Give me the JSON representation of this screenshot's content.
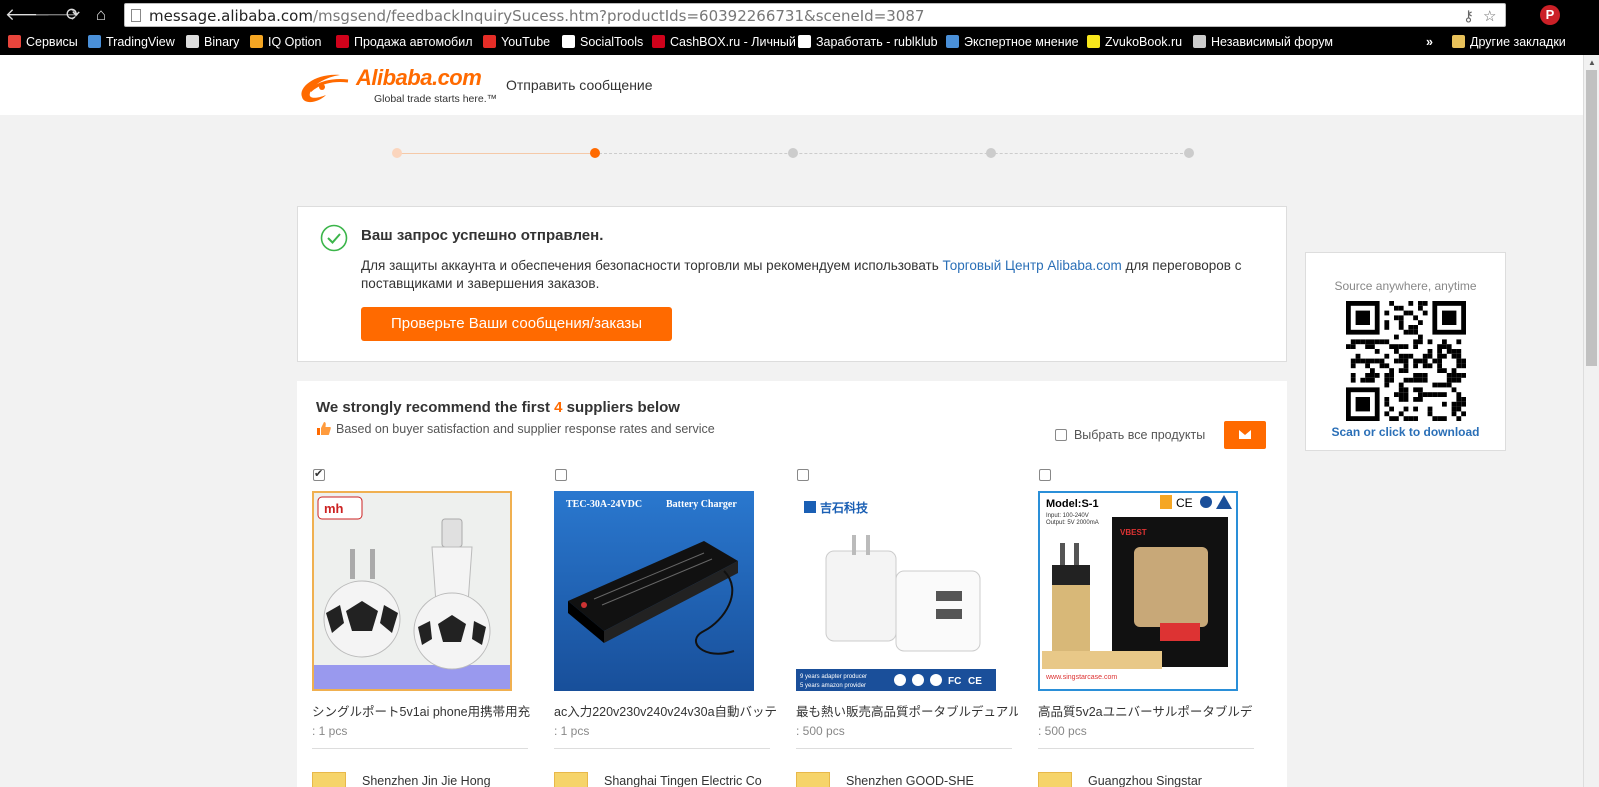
{
  "browser": {
    "url_host": "message.alibaba.com",
    "url_path": "/msgsend/feedbackInquirySucess.htm?productIds=60392266731&sceneId=3087",
    "bookmarks": [
      {
        "label": "Сервисы",
        "color": "#e8453c"
      },
      {
        "label": "TradingView",
        "color": "#4a90d9"
      },
      {
        "label": "Binary",
        "color": "#dddddd"
      },
      {
        "label": "IQ Option",
        "color": "#f5a623"
      },
      {
        "label": "Продажа автомобил",
        "color": "#d0021b"
      },
      {
        "label": "YouTube",
        "color": "#e52d27"
      },
      {
        "label": "SocialTools",
        "color": "#ffffff"
      },
      {
        "label": "CashBOX.ru - Личный",
        "color": "#d0021b"
      },
      {
        "label": "Заработать - rublklub",
        "color": "#ffffff"
      },
      {
        "label": "Экспертное мнение",
        "color": "#4a90d9"
      },
      {
        "label": "ZvukoBook.ru",
        "color": "#f8e71c"
      },
      {
        "label": "Независимый форум",
        "color": "#cccccc"
      }
    ],
    "more": "»",
    "other_bookmarks": "Другие закладки"
  },
  "header": {
    "logo_word": "Alibaba.com",
    "logo_tagline": "Global trade starts here.™",
    "title": "Отправить сообщение"
  },
  "progress": {
    "total_steps": 5,
    "current_step": 2
  },
  "success": {
    "title": "Ваш запрос успешно отправлен.",
    "text_before": "Для защиты аккаунта и обеспечения безопасности торговли мы рекомендуем использовать ",
    "link": "Торговый Центр Alibaba.com",
    "text_after": " для переговоров с поставщиками и завершения заказов.",
    "button": "Проверьте Ваши сообщения/заказы"
  },
  "qr": {
    "caption": "Source anywhere, anytime",
    "link": "Scan or click to download"
  },
  "recommend": {
    "title_before": "We strongly recommend the first ",
    "title_num": "4",
    "title_after": " suppliers below",
    "subtitle": "Based on buyer satisfaction and supplier response rates and service",
    "select_all": "Выбрать все продукты"
  },
  "products": [
    {
      "name": "シングルポート5v1ai phone用携帯用充",
      "qty": ": 1 pcs",
      "supplier": "Shenzhen Jin Jie Hong",
      "checked": true
    },
    {
      "name": "ac入力220v230v240v24v30a自動バッテ",
      "qty": ": 1 pcs",
      "supplier": "Shanghai Tingen Electric Co",
      "checked": false,
      "image_text_1": "TEC-30A-24VDC",
      "image_text_2": "Battery Charger"
    },
    {
      "name": "最も熱い販売高品質ポータブルデュアル",
      "qty": ": 500 pcs",
      "supplier": "Shenzhen GOOD-SHE",
      "checked": false,
      "image_brand": "吉石科技"
    },
    {
      "name": "高品質5v2aユニバーサルポータブルデ",
      "qty": ": 500 pcs",
      "supplier": "Guangzhou Singstar",
      "checked": false,
      "image_model": "Model:S-1",
      "image_url": "www.singstarcase.com"
    }
  ]
}
